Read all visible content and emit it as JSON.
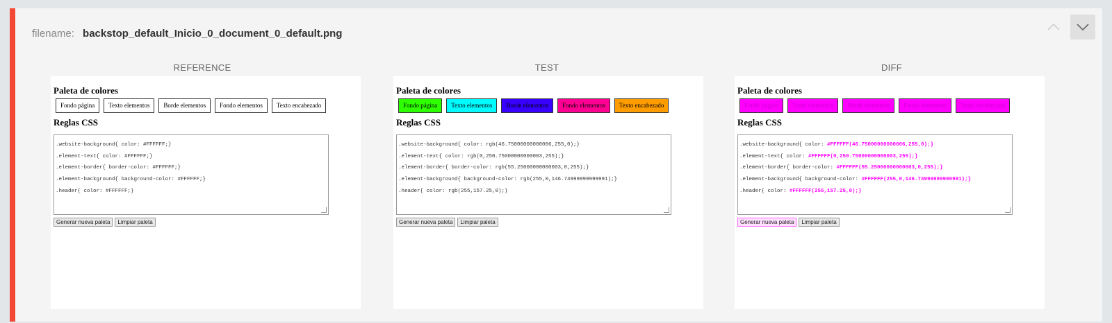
{
  "header": {
    "filename_label": "filename:",
    "filename_value": "backstop_default_Inicio_0_document_0_default.png"
  },
  "controls": {
    "up_icon": "chevron-up-icon",
    "down_icon": "chevron-down-icon"
  },
  "columns": [
    {
      "title": "REFERENCE",
      "paleta_title": "Paleta de colores",
      "reglas_title": "Reglas CSS",
      "swatches": [
        {
          "label": "Fondo página",
          "bg": "#ffffff",
          "border": "#333333",
          "color": "#000000"
        },
        {
          "label": "Texto elementos",
          "bg": "#ffffff",
          "border": "#333333",
          "color": "#000000"
        },
        {
          "label": "Borde elementos",
          "bg": "#ffffff",
          "border": "#333333",
          "color": "#000000"
        },
        {
          "label": "Fondo elementos",
          "bg": "#ffffff",
          "border": "#333333",
          "color": "#000000"
        },
        {
          "label": "Texto encabezado",
          "bg": "#ffffff",
          "border": "#333333",
          "color": "#000000"
        }
      ],
      "css_lines": [
        {
          "pre": ".website-background{ color: #FFFFFF;}",
          "hl": "",
          "post": ""
        },
        {
          "pre": ".element-text{ color: #FFFFFF;}",
          "hl": "",
          "post": ""
        },
        {
          "pre": ".element-border{ border-color: #FFFFFF;}",
          "hl": "",
          "post": ""
        },
        {
          "pre": ".element-background{ background-color: #FFFFFF;}",
          "hl": "",
          "post": ""
        },
        {
          "pre": ".header{ color: #FFFFFF;}",
          "hl": "",
          "post": ""
        }
      ],
      "buttons": [
        "Generar nueva paleta",
        "Limpiar paleta"
      ]
    },
    {
      "title": "TEST",
      "paleta_title": "Paleta de colores",
      "reglas_title": "Reglas CSS",
      "swatches": [
        {
          "label": "Fondo página",
          "bg": "#2eff00",
          "border": "#333333",
          "color": "#000000"
        },
        {
          "label": "Texto elementos",
          "bg": "#00fbff",
          "border": "#333333",
          "color": "#000000"
        },
        {
          "label": "Borde elementos",
          "bg": "#3700ff",
          "border": "#333333",
          "color": "#000000"
        },
        {
          "label": "Fondo elementos",
          "bg": "#ff0092",
          "border": "#333333",
          "color": "#000000"
        },
        {
          "label": "Texto encabezado",
          "bg": "#ff9d00",
          "border": "#333333",
          "color": "#000000"
        }
      ],
      "css_lines": [
        {
          "pre": ".website-background{ color: rgb(46.75000000000006,255,0);}",
          "hl": "",
          "post": ""
        },
        {
          "pre": ".element-text{ color: rgb(0,250.75000000000003,255);}",
          "hl": "",
          "post": ""
        },
        {
          "pre": ".element-border{ border-color: rgb(55.25000000000003,0,255);}",
          "hl": "",
          "post": ""
        },
        {
          "pre": ".element-background{ background-color: rgb(255,0,146.74999999999991);}",
          "hl": "",
          "post": ""
        },
        {
          "pre": ".header{ color: rgb(255,157.25,0);}",
          "hl": "",
          "post": ""
        }
      ],
      "buttons": [
        "Generar nueva paleta",
        "Limpiar paleta"
      ]
    },
    {
      "title": "DIFF",
      "paleta_title": "Paleta de colores",
      "reglas_title": "Reglas CSS",
      "swatches": [
        {
          "label": "Fondo página",
          "bg": "#ff00ff",
          "border": "#333333",
          "color": "#cc00cc"
        },
        {
          "label": "Texto elementos",
          "bg": "#ff00ff",
          "border": "#333333",
          "color": "#cc00cc"
        },
        {
          "label": "Borde elementos",
          "bg": "#ff00ff",
          "border": "#333333",
          "color": "#cc00cc"
        },
        {
          "label": "Fondo elementos",
          "bg": "#ff00ff",
          "border": "#333333",
          "color": "#cc00cc"
        },
        {
          "label": "Texto encabezado",
          "bg": "#ff00ff",
          "border": "#333333",
          "color": "#cc00cc"
        }
      ],
      "css_lines": [
        {
          "pre": ".website-background{ color: ",
          "hl": "#FFFFFF",
          "post": "(46.75000000000006,255,0);}"
        },
        {
          "pre": ".element-text{ color: ",
          "hl": "#FFFFFF",
          "post": "(0,250.75000000000003,255);}"
        },
        {
          "pre": ".element-border{ border-color: ",
          "hl": "#FFFFFF",
          "post": "(55.25000000000003,0,255);}"
        },
        {
          "pre": ".element-background{ background-color: ",
          "hl": "#FFFFFF",
          "post": "(255,0,146.74999999999991);}"
        },
        {
          "pre": ".header{ color: ",
          "hl": "#FFFFFF",
          "post": "(255,157.25,0);}"
        }
      ],
      "buttons": [
        "Generar nueva paleta",
        "Limpiar paleta"
      ]
    }
  ],
  "colors": {
    "accent": "#f44836",
    "diff": "#ff00ff"
  }
}
